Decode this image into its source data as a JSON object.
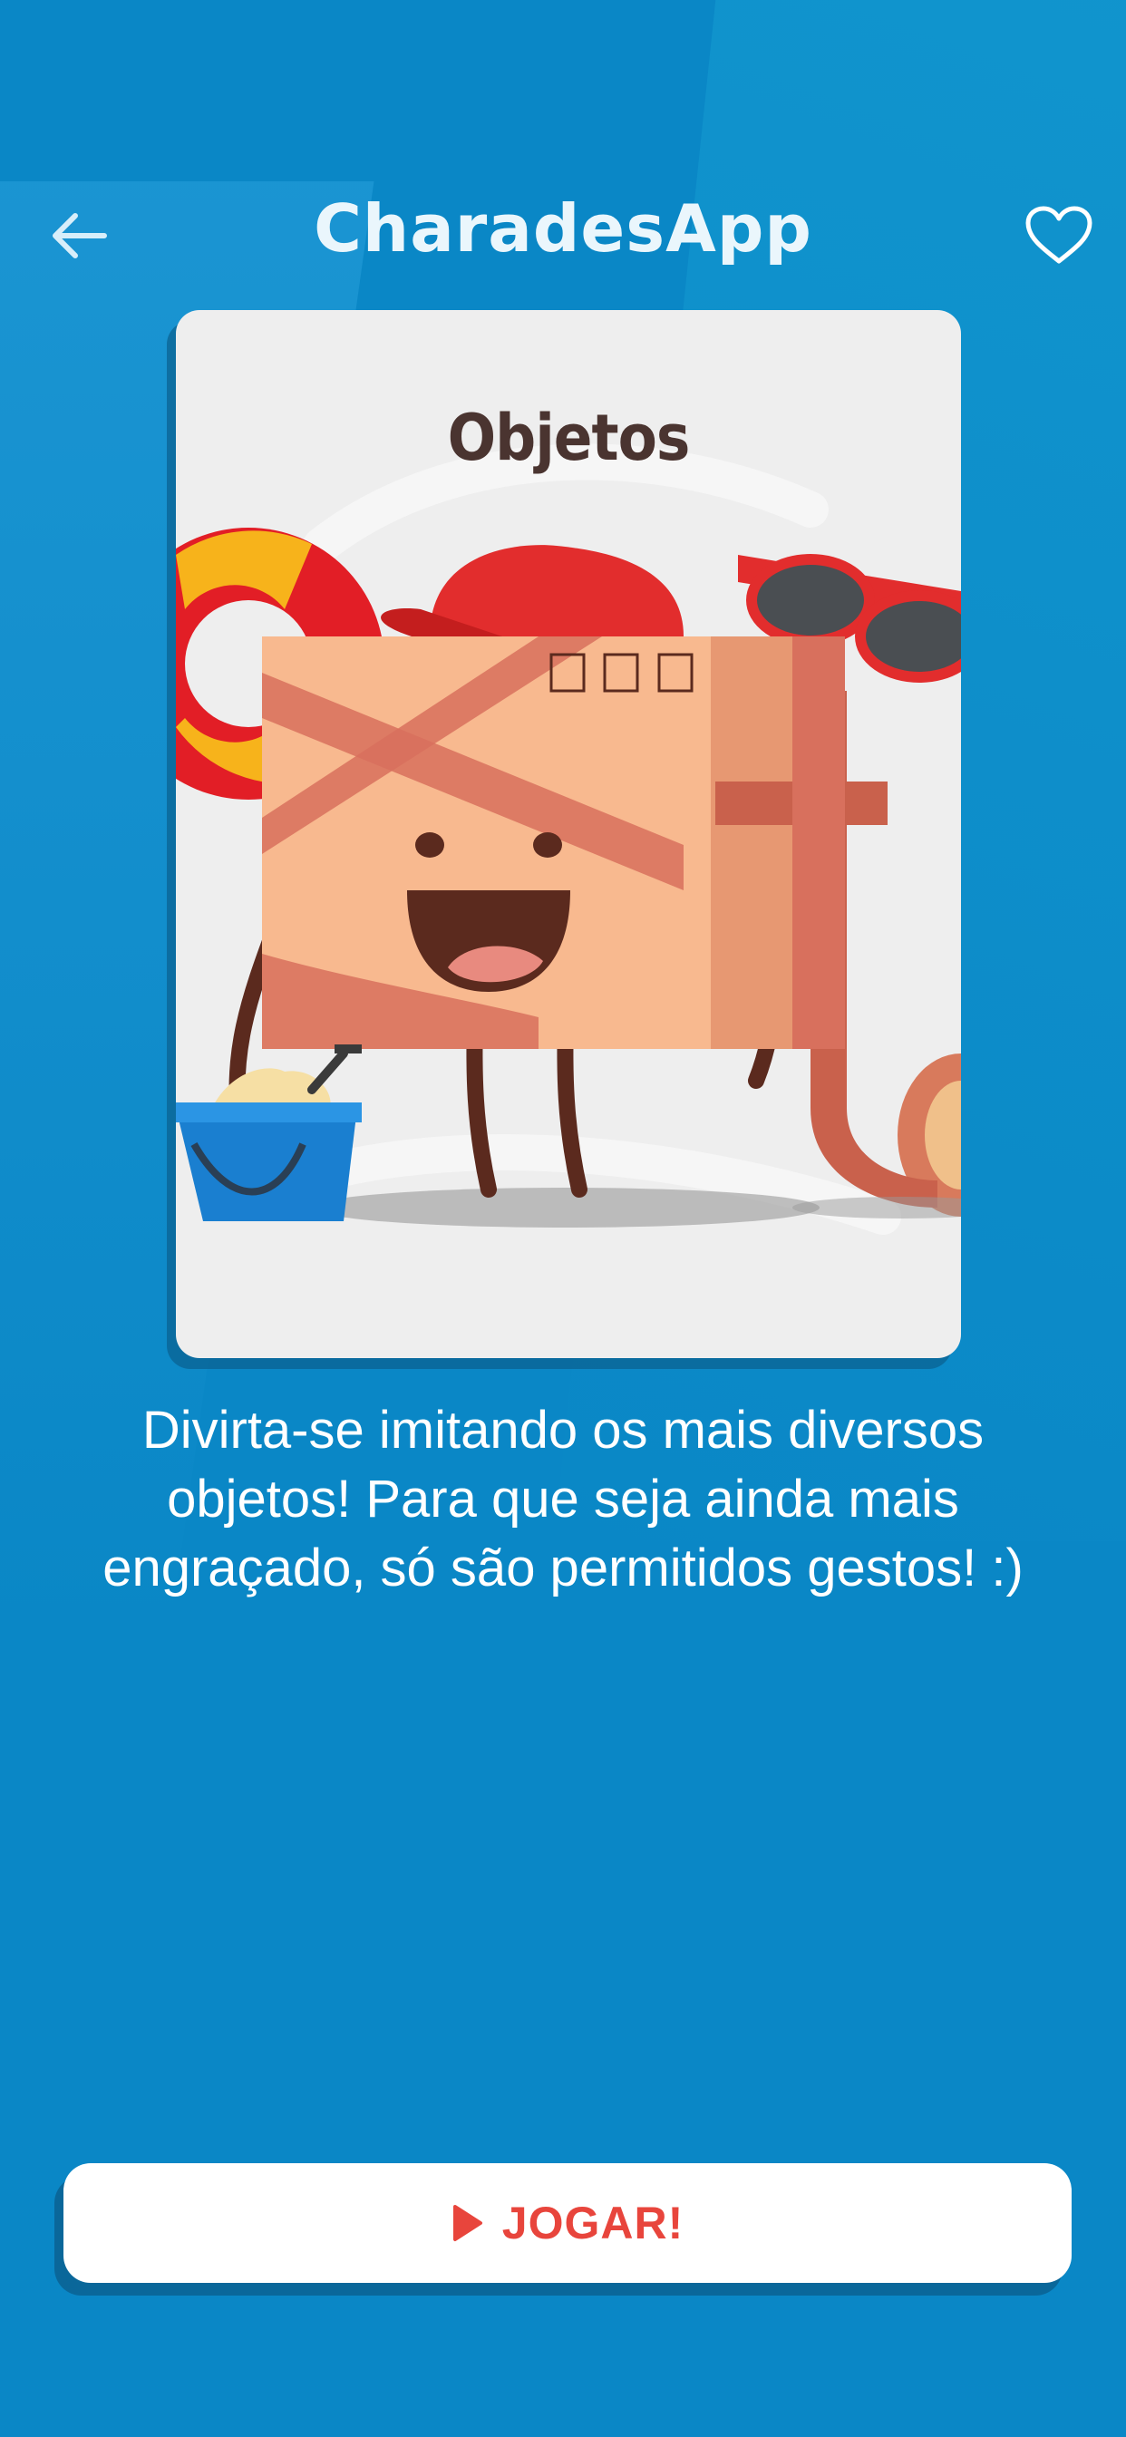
{
  "header": {
    "title": "CharadesApp",
    "back_icon": "arrow-left-icon",
    "favorite_icon": "heart-outline-icon"
  },
  "card": {
    "title": "Objetos"
  },
  "description": "Divirta-se imitando os mais diversos objetos! Para que seja ainda mais engraçado, só são permitidos gestos! :)",
  "play_button": {
    "label": "JOGAR!",
    "icon": "play-icon"
  },
  "colors": {
    "background": "#0a87c6",
    "card": "#eeeeee",
    "accent": "#e8453c",
    "title_text": "#eaf6fc"
  }
}
